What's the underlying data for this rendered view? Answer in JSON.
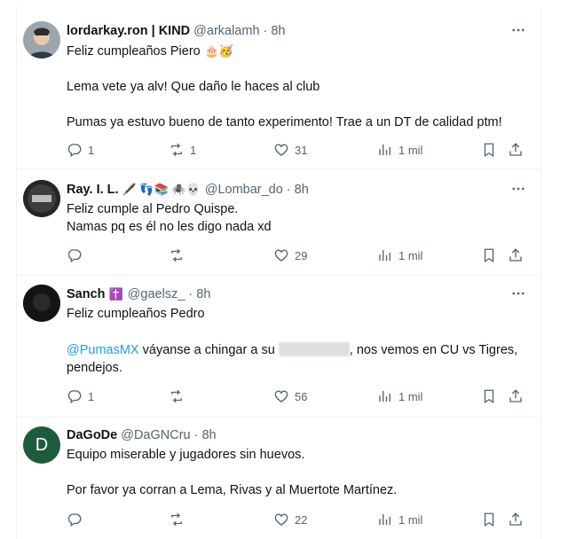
{
  "tweets": [
    {
      "name": "lordarkay.ron | KIND",
      "handle": "@arkalamh",
      "time": "8h",
      "emoji": "🎂🥳",
      "lines": [
        "Feliz cumpleaños Piero",
        "Lema vete ya alv! Que daño le haces al club",
        "Pumas ya estuvo bueno de tanto experimento! Trae a un DT de calidad ptm!"
      ],
      "replies": "1",
      "retweets": "1",
      "likes": "31",
      "views": "1 mil"
    },
    {
      "name": "Ray. I. L.",
      "name_emoji": "🖋️ 👣📚 🕷️💀",
      "handle": "@Lombar_do",
      "time": "8h",
      "lines": [
        "Feliz cumple al Pedro Quispe.",
        "Namas pq es él no les digo nada xd"
      ],
      "replies": "",
      "retweets": "",
      "likes": "29",
      "views": "1 mil"
    },
    {
      "name": "Sanch",
      "name_emoji": "✝️",
      "handle": "@gaelsz_",
      "time": "8h",
      "lines": [
        "Feliz cumpleaños Pedro",
        "@PumasMX",
        " váyanse a chingar a su ",
        ", nos vemos en CU vs Tigres,",
        "pendejos."
      ],
      "replies": "1",
      "retweets": "",
      "likes": "56",
      "views": "1 mil"
    },
    {
      "name": "DaGoDe",
      "handle": "@DaGNCru",
      "time": "8h",
      "avatar_letter": "D",
      "lines": [
        "Equipo miserable y jugadores sin huevos.",
        "Por favor ya corran a Lema, Rivas y al Muertote Martínez."
      ],
      "replies": "",
      "retweets": "",
      "likes": "22",
      "views": "1 mil"
    }
  ],
  "dot": "·",
  "colors": {
    "accent": "#1d9bf0",
    "muted": "#536471",
    "avatar_green": "#1e5b3c"
  }
}
